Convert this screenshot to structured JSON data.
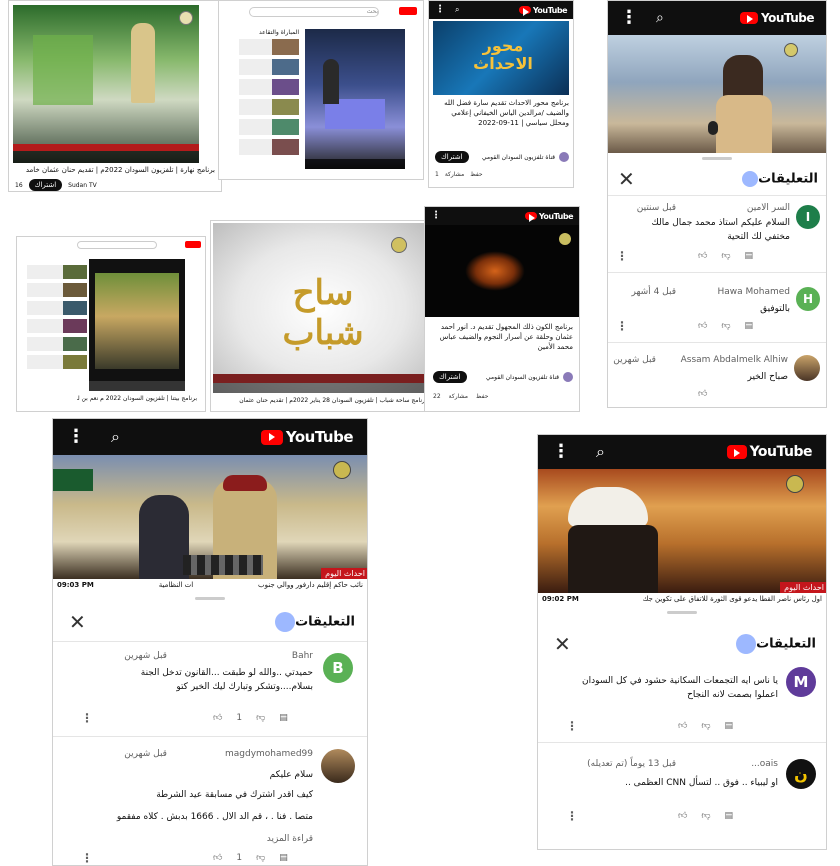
{
  "youtube_logo_text": "YouTube",
  "thumbs": {
    "t1": {
      "caption": "برنامج نهارة | تلفزيون السودان 2022م | تقديم حنان عثمان خامد",
      "channel": "Sudan TV",
      "subscribe": "اشتراك",
      "likes": "16"
    },
    "t2": {
      "search_placeholder": "بحث",
      "sidebar_title": "المباراة والتقاعد"
    },
    "t3": {
      "banner_title": "محور الاحداث",
      "caption": "برنامج محور الاحداث تقديم سارة فضل الله والضيف /مرالدين الياس الخيفاني إعلامي ومحلل سياسي | 11-09-2022",
      "channel": "قناة تلفزيون السودان القومي",
      "subscribe": "اشتراك",
      "likes": "1",
      "share": "مشاركة",
      "save": "حفظ"
    },
    "t4": {
      "caption": "برنامج بيتنا | تلفزيون السودان 2022 م نعم بن لماد"
    },
    "t5": {
      "logo_text": "ساح شباب",
      "caption": "برنامج ساحة شباب | تلفزيون السودان 28 يناير 2022م | تقديم حنان عثمان"
    },
    "t6": {
      "caption": "برنامج الكون ذلك المجهول تقديم د. أنور أحمد عثمان وحلقة عن أسرار النجوم والضيف عباس محمد الأمين",
      "channel": "قناة تلفزيون السودان القومي",
      "subscribe": "اشتراك",
      "likes": "22",
      "share": "مشاركة",
      "save": "حفظ"
    }
  },
  "panel_tr": {
    "sheet_title": "التعليقات",
    "comments": [
      {
        "name": "السر الامين",
        "time": "قبل سنتين",
        "text": "السلام عليكم استاذ محمد جمال مالك مختفي لك التحية",
        "avatar": "I"
      },
      {
        "name": "Hawa Mohamed",
        "time": "قبل 4 أشهر",
        "text": "بالتوفيق",
        "avatar": "H"
      },
      {
        "name": "Assam Abdalmelk Alhiw",
        "time": "قبل شهرين",
        "text": "صباح الخير",
        "avatar": ""
      }
    ]
  },
  "panel_bl": {
    "ticker_text": "نائب حاكم إقليم دارفور ووالي جنوب",
    "ticker_text2": "ات النظامية",
    "ticker_label": "احداث اليوم",
    "time": "09:03 PM",
    "sheet_title": "التعليقات",
    "comments": [
      {
        "name": "Bahr",
        "time": "قبل شهرين",
        "text": "حميدتي ..والله لو طبقت ...القانون تدخل الجنة بسلام....وتشكر وتبارك ليك الخير كتو",
        "likes": "1",
        "avatar": "B"
      },
      {
        "name": "magdymohamed99",
        "time": "قبل شهرين",
        "text1": "سلام عليكم",
        "text2": "كيف اقدر اشترك في مسابقة عيد الشرطة",
        "text3": "متصا . فنا . ، قم الد الال . 1666 بدبش . كلاه مفقمو",
        "more": "قراءة المزيد",
        "likes": "1",
        "avatar": ""
      }
    ]
  },
  "panel_br": {
    "ticker_text": "اول رئاس ناصر القطا يدعو قوى الثورة للاتفاق على تكوين جك",
    "ticker_label": "احداث اليوم",
    "time": "09:02 PM",
    "sheet_title": "التعليقات",
    "comments": [
      {
        "name": "",
        "time": "",
        "text": "يا ناس ايه التجمعات السكانية حشود في كل السودان اعملوا بصمت لانه النجاح",
        "avatar": "M"
      },
      {
        "name": "oais...",
        "time": "قبل 13 يوماً (تم تعديله)",
        "text": "او ليبياء .. فوق .. لتسأل CNN العظمى ..",
        "avatar": "ن"
      }
    ]
  },
  "colors": {
    "yt_red": "#ff0000",
    "avatar_green": "#1e7e4a",
    "avatar_green2": "#5ab155",
    "avatar_purple": "#5f3b9a",
    "ticker_red": "#c4161c"
  }
}
